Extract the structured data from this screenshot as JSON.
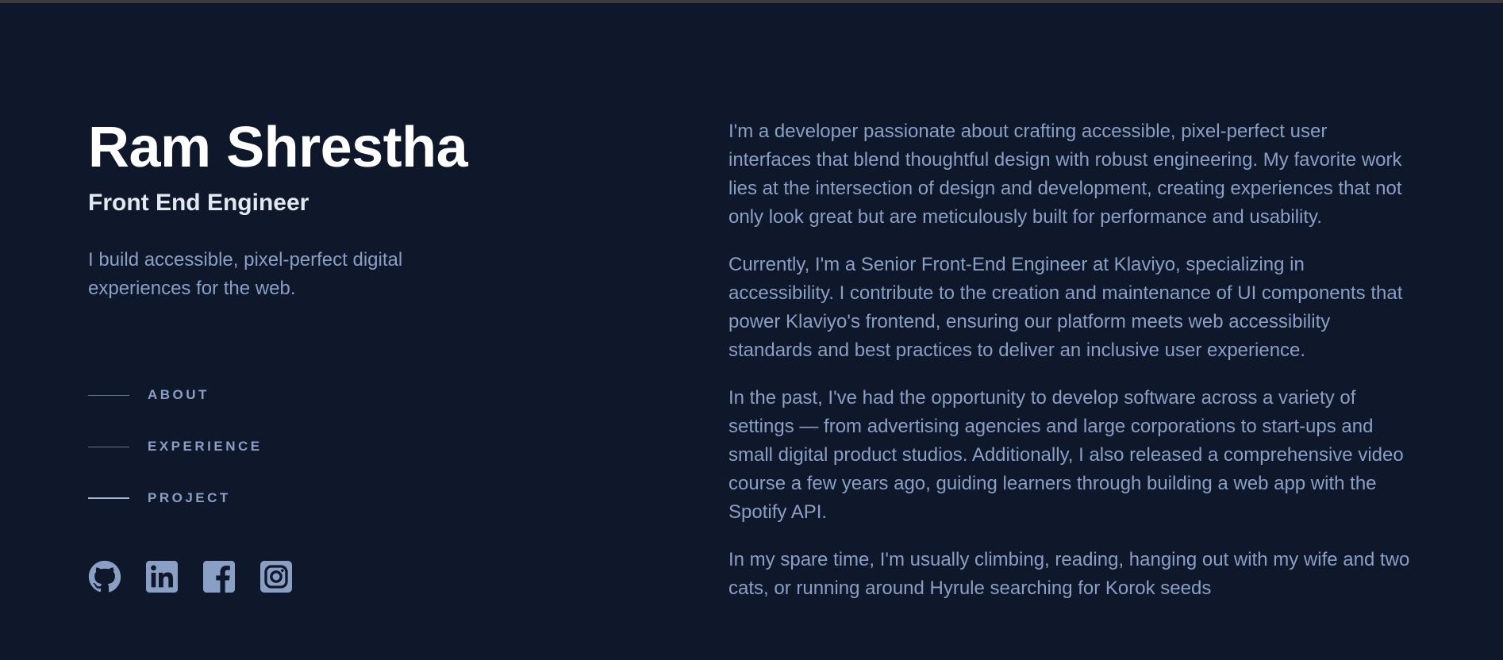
{
  "profile": {
    "name": "Ram Shrestha",
    "role": "Front End Engineer",
    "tagline": "I build accessible, pixel-perfect digital experiences for the web."
  },
  "nav": {
    "items": [
      {
        "label": "ABOUT"
      },
      {
        "label": "EXPERIENCE"
      },
      {
        "label": "PROJECT"
      }
    ]
  },
  "social": {
    "icons": [
      "github-icon",
      "linkedin-icon",
      "facebook-icon",
      "instagram-icon"
    ]
  },
  "about": {
    "paragraphs": [
      "I'm a developer passionate about crafting accessible, pixel-perfect user interfaces that blend thoughtful design with robust engineering. My favorite work lies at the intersection of design and development, creating experiences that not only look great but are meticulously built for performance and usability.",
      "Currently, I'm a Senior Front-End Engineer at Klaviyo, specializing in accessibility. I contribute to the creation and maintenance of UI components that power Klaviyo's frontend, ensuring our platform meets web accessibility standards and best practices to deliver an inclusive user experience.",
      "In the past, I've had the opportunity to develop software across a variety of settings — from advertising agencies and large corporations to start-ups and small digital product studios. Additionally, I also released a comprehensive video course a few years ago, guiding learners through building a web app with the Spotify API.",
      "In my spare time, I'm usually climbing, reading, hanging out with my wife and two cats, or running around Hyrule searching for Korok seeds"
    ]
  },
  "colors": {
    "background": "#0f172a",
    "heading": "#ffffff",
    "text": "#8a9fc4",
    "active_line": "#a6b7d6"
  }
}
